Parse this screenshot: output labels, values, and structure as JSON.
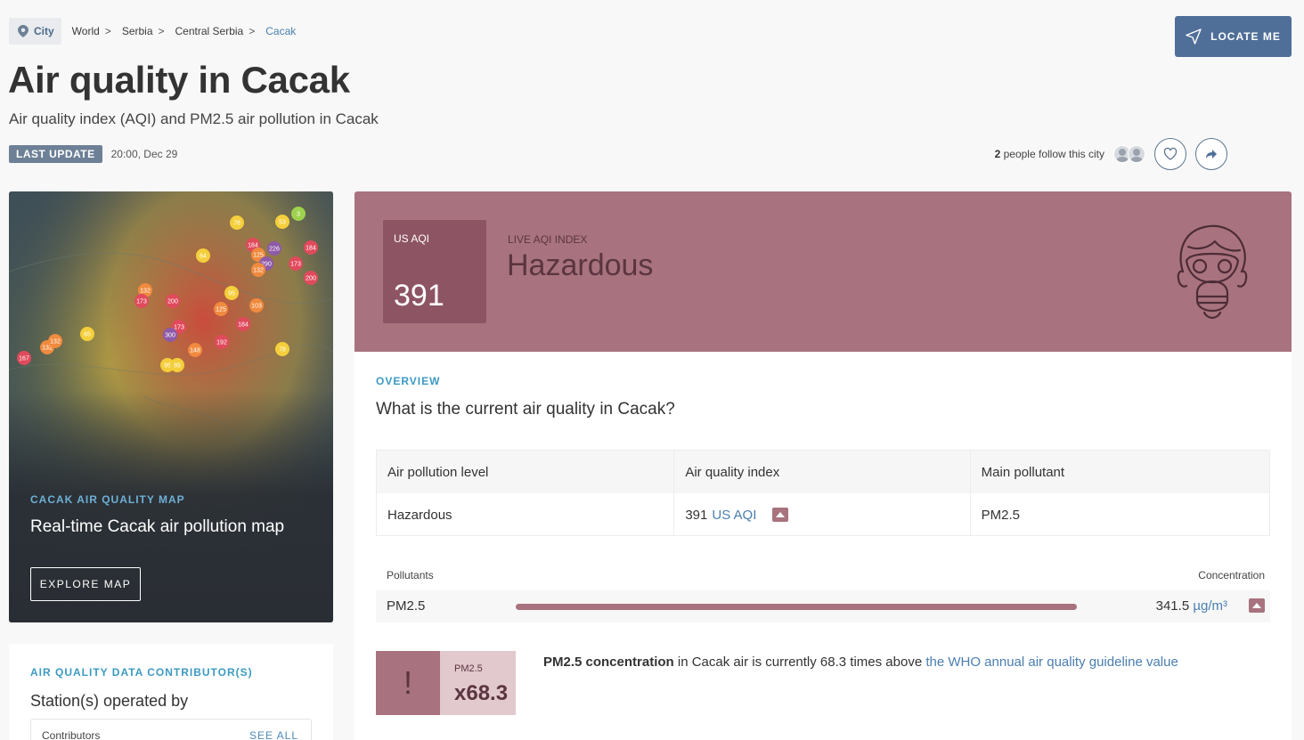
{
  "breadcrumb": {
    "chip_label": "City",
    "items": [
      "World",
      "Serbia",
      "Central Serbia",
      "Cacak"
    ],
    "separator": ">"
  },
  "locate_button": {
    "label": "LOCATE ME",
    "icon": "navigation-arrow-icon"
  },
  "page": {
    "title": "Air quality in Cacak",
    "subtitle": "Air quality index (AQI) and PM2.5 air pollution in Cacak"
  },
  "update": {
    "badge": "LAST UPDATE",
    "time": "20:00, Dec 29"
  },
  "follow": {
    "count": "2",
    "text": "people follow this city",
    "heart_icon": "heart-icon",
    "share_icon": "share-icon"
  },
  "map_card": {
    "eyebrow": "CACAK AIR QUALITY MAP",
    "title": "Real-time Cacak air pollution map",
    "button": "EXPLORE MAP",
    "markers": [
      {
        "label": "78",
        "color": "#f4cf3b"
      },
      {
        "label": "3",
        "color": "#9ed24e"
      },
      {
        "label": "53",
        "color": "#f4cf3b"
      },
      {
        "label": "64",
        "color": "#f4cf3b"
      },
      {
        "label": "184",
        "color": "#e04a5c"
      },
      {
        "label": "226",
        "color": "#8e5aa8"
      },
      {
        "label": "184",
        "color": "#e04a5c"
      },
      {
        "label": "125",
        "color": "#f08a3e"
      },
      {
        "label": "290",
        "color": "#8e5aa8"
      },
      {
        "label": "173",
        "color": "#e04a5c"
      },
      {
        "label": "200",
        "color": "#e04a5c"
      },
      {
        "label": "132",
        "color": "#f08a3e"
      },
      {
        "label": "95",
        "color": "#f4cf3b"
      },
      {
        "label": "132",
        "color": "#f08a3e"
      },
      {
        "label": "173",
        "color": "#e04a5c"
      },
      {
        "label": "200",
        "color": "#e04a5c"
      },
      {
        "label": "125",
        "color": "#f08a3e"
      },
      {
        "label": "103",
        "color": "#f08a3e"
      },
      {
        "label": "184",
        "color": "#e04a5c"
      },
      {
        "label": "173",
        "color": "#e04a5c"
      },
      {
        "label": "300",
        "color": "#8e5aa8"
      },
      {
        "label": "192",
        "color": "#e04a5c"
      },
      {
        "label": "148",
        "color": "#f08a3e"
      },
      {
        "label": "78",
        "color": "#f4cf3b"
      },
      {
        "label": "95",
        "color": "#f4cf3b"
      },
      {
        "label": "85",
        "color": "#f4cf3b"
      },
      {
        "label": "132",
        "color": "#f08a3e"
      },
      {
        "label": "167",
        "color": "#e04a5c"
      },
      {
        "label": "65",
        "color": "#f4cf3b"
      },
      {
        "label": "132",
        "color": "#f08a3e"
      }
    ]
  },
  "contributors": {
    "eyebrow": "AIR QUALITY DATA CONTRIBUTOR(S)",
    "title": "Station(s) operated by",
    "label": "Contributors",
    "see_all": "SEE ALL"
  },
  "aqi": {
    "box_label": "US AQI",
    "value": "391",
    "live_label": "LIVE AQI INDEX",
    "status": "Hazardous",
    "status_color": "#a8737e",
    "icon": "gas-mask-icon"
  },
  "overview": {
    "eyebrow": "OVERVIEW",
    "question": "What is the current air quality in Cacak?",
    "table": {
      "headers": [
        "Air pollution level",
        "Air quality index",
        "Main pollutant"
      ],
      "level": "Hazardous",
      "aqi_value": "391",
      "aqi_unit": "US AQI",
      "main_pollutant": "PM2.5"
    }
  },
  "pollutants": {
    "col_pollutants": "Pollutants",
    "col_concentration": "Concentration",
    "rows": [
      {
        "name": "PM2.5",
        "value": "341.5",
        "unit": "µg/m³"
      }
    ]
  },
  "who": {
    "box_label": "PM2.5",
    "multiplier": "x68.3",
    "bold": "PM2.5 concentration",
    "text": " in Cacak air is currently 68.3 times above ",
    "link": "the WHO annual air quality guideline value"
  }
}
